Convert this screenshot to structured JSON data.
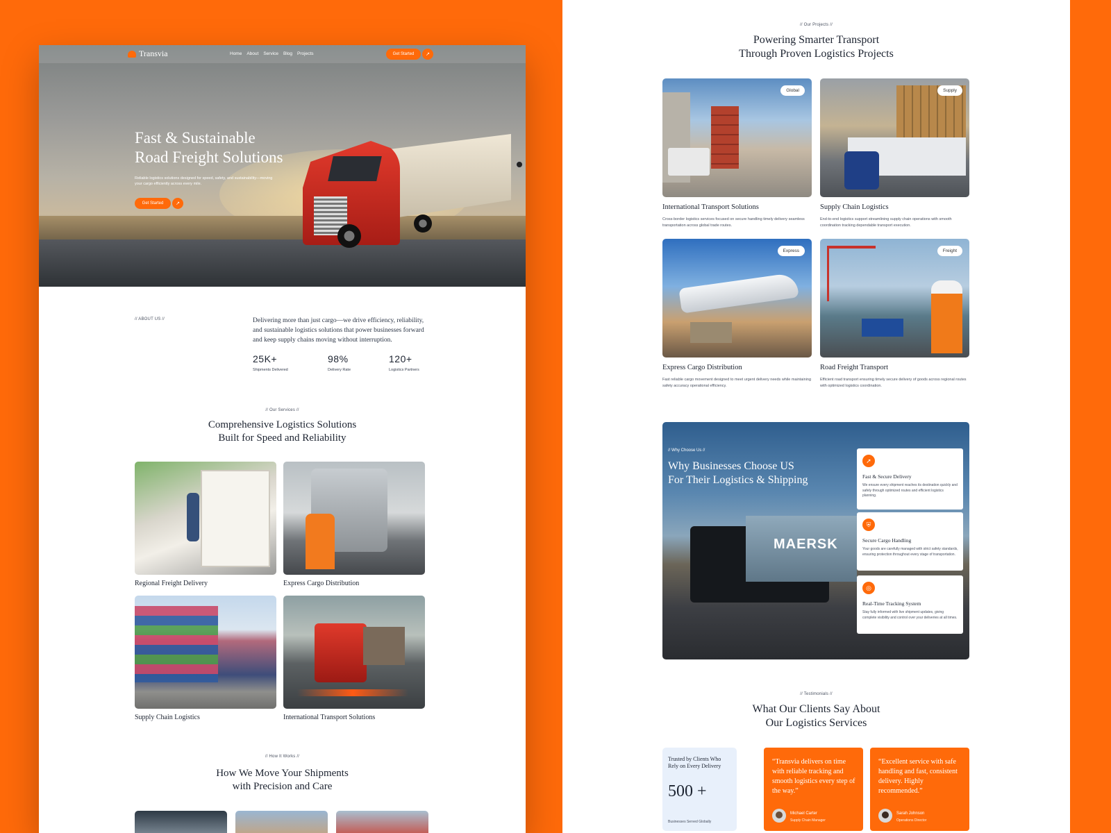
{
  "colors": {
    "accent": "#ff6a0a",
    "text": "#1c2330",
    "panel": "#e8f0fb"
  },
  "brand": {
    "name": "Transvia"
  },
  "nav": {
    "links": [
      "Home",
      "About",
      "Service",
      "Blog",
      "Projects"
    ],
    "cta": "Get Started",
    "cta_icon": "arrow-up-right-icon"
  },
  "hero": {
    "title_line1": "Fast & Sustainable",
    "title_line2": "Road Freight Solutions",
    "subtitle": "Reliable logistics solutions designed for speed, safety, and sustainability—moving your cargo efficiently across every mile.",
    "cta": "Get Started"
  },
  "about": {
    "eyebrow": "// ABOUT US //",
    "text": "Delivering more than just cargo—we drive efficiency, reliability, and sustainable logistics solutions that power businesses forward and keep supply chains moving without interruption.",
    "stats": [
      {
        "value": "25K+",
        "label": "Shipments Delivered"
      },
      {
        "value": "98%",
        "label": "Delivery Rate"
      },
      {
        "value": "120+",
        "label": "Logistics Partners"
      }
    ]
  },
  "services": {
    "eyebrow": "// Our Services //",
    "title_line1": "Comprehensive Logistics Solutions",
    "title_line2": "Built for Speed and Reliability",
    "items": [
      {
        "title": "Regional Freight Delivery"
      },
      {
        "title": "Express Cargo Distribution"
      },
      {
        "title": "Supply Chain Logistics"
      },
      {
        "title": "International Transport Solutions"
      }
    ]
  },
  "how": {
    "eyebrow": "// How It Works //",
    "title_line1": "How We Move Your Shipments",
    "title_line2": "with Precision and Care"
  },
  "projects": {
    "eyebrow": "// Our Projects //",
    "title_line1": "Powering Smarter Transport",
    "title_line2": "Through Proven Logistics Projects",
    "items": [
      {
        "tag": "Global",
        "title": "International Transport Solutions",
        "desc": "Cross-border logistics services focused on secure handling timely delivery seamless transportation across global trade routes."
      },
      {
        "tag": "Supply",
        "title": "Supply Chain Logistics",
        "desc": "End-to-end logistics support streamlining supply chain operations with smooth coordination tracking dependable transport execution."
      },
      {
        "tag": "Express",
        "title": "Express Cargo Distribution",
        "desc": "Fast reliable cargo movement designed to meet urgent delivery needs while maintaining safety accuracy operational efficiency."
      },
      {
        "tag": "Freight",
        "title": "Road Freight Transport",
        "desc": "Efficient road transport ensuring timely secure delivery of goods across regional routes with optimized logistics coordination."
      }
    ]
  },
  "why": {
    "eyebrow": "// Why Choose Us //",
    "title_line1": "Why Businesses Choose US",
    "title_line2": "For Their Logistics & Shipping",
    "container_text": "MAERSK",
    "features": [
      {
        "icon": "rocket-icon",
        "title": "Fast & Secure Delivery",
        "desc": "We ensure every shipment reaches its destination quickly and safely through optimized routes and efficient logistics planning."
      },
      {
        "icon": "shield-icon",
        "title": "Secure Cargo Handling",
        "desc": "Your goods are carefully managed with strict safety standards, ensuring protection throughout every stage of transportation."
      },
      {
        "icon": "tracking-icon",
        "title": "Real-Time Tracking System",
        "desc": "Stay fully informed with live shipment updates, giving complete visibility and control over your deliveries at all times."
      }
    ]
  },
  "testimonials": {
    "eyebrow": "// Testimonials //",
    "title_line1": "What Our Clients Say About",
    "title_line2": "Our Logistics Services",
    "stat_heading": "Trusted by Clients Who Rely on Every Delivery",
    "stat_value": "500 +",
    "stat_label": "Businesses Served Globally",
    "items": [
      {
        "quote": "“Transvia delivers on time with reliable tracking and smooth logistics every step of the way.”",
        "name": "Michael Carter",
        "role": "Supply Chain Manager"
      },
      {
        "quote": "“Excellent service with safe handling and fast, consistent delivery. Highly recommended.”",
        "name": "Sarah Johnson",
        "role": "Operations Director"
      }
    ]
  }
}
